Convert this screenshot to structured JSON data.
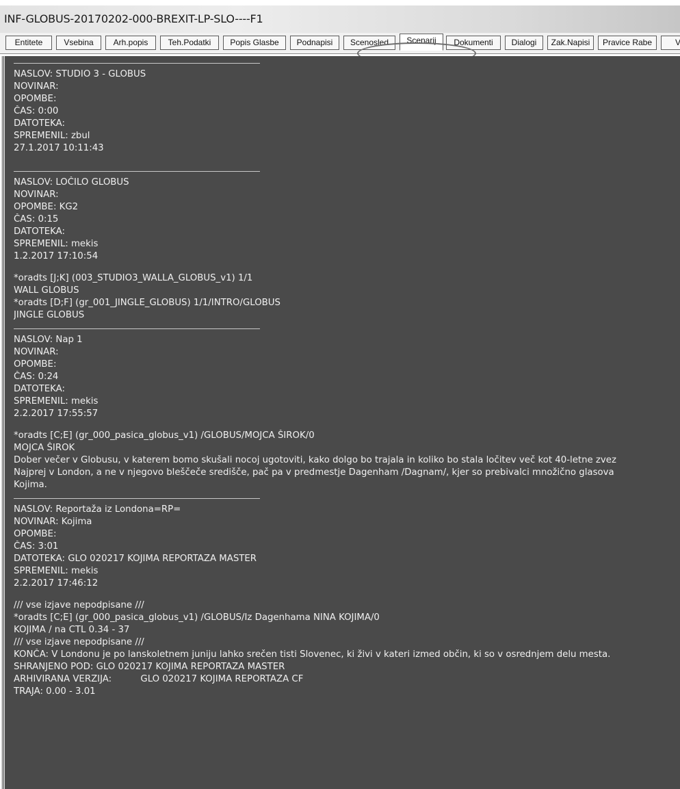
{
  "window": {
    "title": "INF-GLOBUS-20170202-000-BREXIT-LP-SLO----F1"
  },
  "tabs": [
    {
      "label": "Entitete"
    },
    {
      "label": "Vsebina"
    },
    {
      "label": "Arh.popis"
    },
    {
      "label": "Teh.Podatki"
    },
    {
      "label": "Popis Glasbe"
    },
    {
      "label": "Podnapisi"
    },
    {
      "label": "Scenosled"
    },
    {
      "label": "Scenarij"
    },
    {
      "label": "Dokumenti"
    },
    {
      "label": "Dialogi"
    },
    {
      "label": "Zak.Napisi"
    },
    {
      "label": "Pravice Rabe"
    },
    {
      "label": "V"
    }
  ],
  "active_tab": "Scenarij",
  "colors": {
    "content_bg": "#4a4a4a",
    "content_text": "#f0f0f0",
    "titlebar": "#e6e6e6"
  },
  "script": {
    "segment1": [
      "NASLOV: STUDIO 3 - GLOBUS",
      "NOVINAR:",
      "OPOMBE:",
      "ČAS: 0:00",
      "DATOTEKA:",
      "SPREMENIL: zbul",
      "27.1.2017 10:11:43"
    ],
    "segment2": [
      "NASLOV: LOČILO GLOBUS",
      "NOVINAR:",
      "OPOMBE: KG2",
      "ČAS: 0:15",
      "DATOTEKA:",
      "SPREMENIL: mekis",
      "1.2.2017 17:10:54"
    ],
    "segment2_body": [
      "*oradts [J;K] (003_STUDIO3_WALLA_GLOBUS_v1) 1/1",
      "WALL GLOBUS",
      "*oradts [D;F] (gr_001_JINGLE_GLOBUS) 1/1/INTRO/GLOBUS",
      "JINGLE GLOBUS"
    ],
    "segment3": [
      "NASLOV: Nap 1",
      "NOVINAR:",
      "OPOMBE:",
      "ČAS: 0:24",
      "DATOTEKA:",
      "SPREMENIL: mekis",
      "2.2.2017 17:55:57"
    ],
    "segment3_body": [
      "*oradts [C;E] (gr_000_pasica_globus_v1) /GLOBUS/MOJCA ŠIROK/0",
      "MOJCA ŠIROK",
      "Dober večer v Globusu, v katerem bomo skušali nocoj  ugotoviti, kako dolgo bo trajala in koliko bo stala ločitev več kot 40-letne zvez",
      "Najprej v London, a ne v njegovo bleščeče središče, pač pa v predmestje Dagenham /Dagnam/, kjer so prebivalci množično glasova",
      "Kojima."
    ],
    "segment4": [
      "NASLOV: Reportaža iz Londona=RP=",
      "NOVINAR: Kojima",
      "OPOMBE:",
      "ČAS: 3:01",
      "DATOTEKA: GLO 020217 KOJIMA REPORTAZA MASTER",
      "SPREMENIL: mekis",
      "2.2.2017 17:46:12"
    ],
    "segment4_body": [
      "/// vse izjave nepodpisane ///",
      "*oradts [C;E] (gr_000_pasica_globus_v1) /GLOBUS/Iz Dagenhama NINA KOJIMA/0",
      "KOJIMA / na CTL 0.34 - 37",
      "/// vse izjave nepodpisane ///",
      "KONČA: V Londonu je po lanskoletnem juniju lahko srečen tisti Slovenec, ki živi v kateri izmed občin, ki so v osrednjem delu mesta.",
      "SHRANJENO POD:  GLO 020217 KOJIMA REPORTAZA MASTER",
      "ARHIVIRANA VERZIJA:          GLO 020217 KOJIMA REPORTAZA CF",
      "TRAJA: 0.00 - 3.01"
    ]
  }
}
